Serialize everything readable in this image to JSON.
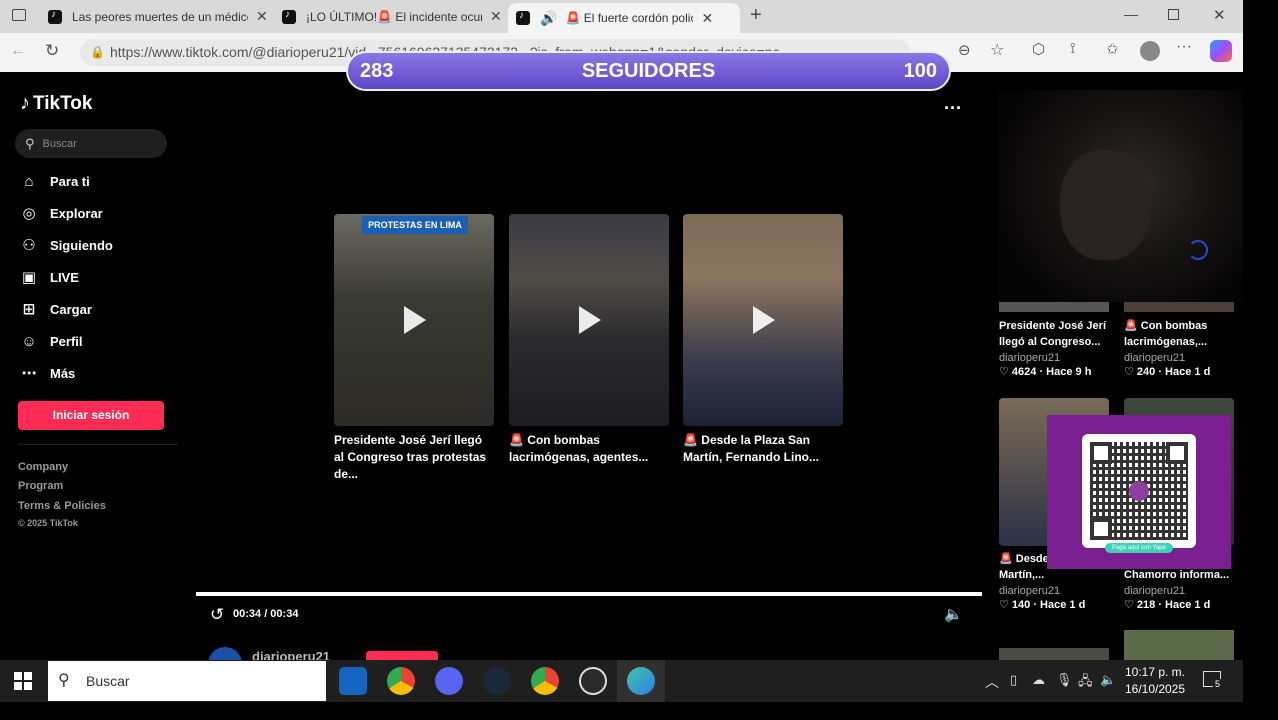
{
  "browser": {
    "tabs": [
      {
        "title": "Las peores muertes de un médico"
      },
      {
        "title": "¡LO ÚLTIMO!🚨 El incidente ocurrido"
      },
      {
        "title": "🚨 El fuerte cordón policial"
      }
    ],
    "url": "https://www.tiktok.com/@diarioperu21/vid...756169627135472172...?is_from_webapp=1&sender_device=pc"
  },
  "sidebar": {
    "logo": "TikTok",
    "search_placeholder": "Buscar",
    "nav": [
      {
        "label": "Para ti",
        "icon": "home-icon"
      },
      {
        "label": "Explorar",
        "icon": "compass-icon"
      },
      {
        "label": "Siguiendo",
        "icon": "following-icon"
      },
      {
        "label": "LIVE",
        "icon": "live-icon"
      },
      {
        "label": "Cargar",
        "icon": "upload-icon"
      },
      {
        "label": "Perfil",
        "icon": "profile-icon"
      },
      {
        "label": "Más",
        "icon": "more-icon"
      }
    ],
    "login_label": "Iniciar sesión",
    "footer": {
      "company": "Company",
      "program": "Program",
      "terms": "Terms & Policies",
      "copyright": "© 2025 TikTok"
    }
  },
  "overlay": {
    "followers_count": "283",
    "followers_label": "SEGUIDORES",
    "followers_goal": "100",
    "qr_caption": "Paga aquí con Yape"
  },
  "player": {
    "badge_text": "PROTESTAS EN LIMA",
    "time": "00:34 / 00:34",
    "author": "diarioperu21",
    "progress": 1.0
  },
  "cards": [
    {
      "caption": "Presidente José Jerí llegó al Congreso tras protestas de..."
    },
    {
      "caption": "🚨 Con bombas lacrimógenas, agentes..."
    },
    {
      "caption": "🚨 Desde la Plaza San Martín, Fernando Lino..."
    }
  ],
  "related": [
    {
      "title": "Presidente José Jerí llegó al Congreso...",
      "author": "diarioperu21",
      "stats": "♡ 4624 · Hace 9 h"
    },
    {
      "title": "🚨 Con bombas lacrimógenas,...",
      "author": "diarioperu21",
      "stats": "♡ 240 · Hace 1 d"
    },
    {
      "title": "🚨 Desde San Martín,...",
      "author": "diarioperu21",
      "stats": "♡ 140 · Hace 1 d"
    },
    {
      "title": "Chamorro informa...",
      "author": "diarioperu21",
      "stats": "♡ 218 · Hace 1 d"
    }
  ],
  "taskbar": {
    "search_label": "Buscar",
    "time": "10:17 p. m.",
    "date": "16/10/2025",
    "notifications": "5"
  }
}
